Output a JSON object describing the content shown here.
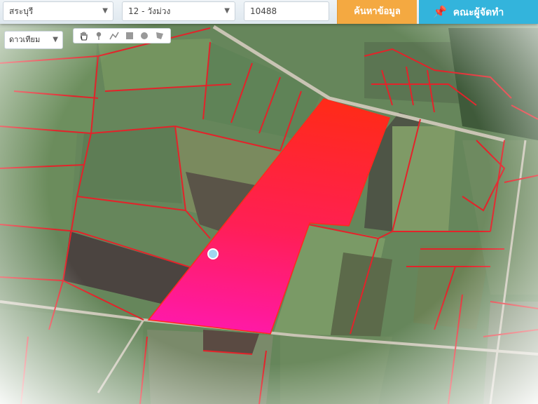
{
  "header": {
    "province": "สระบุรี",
    "district": "12 - วังม่วง",
    "parcel_number": "10488",
    "search_label": "ค้นหาข้อมูล",
    "dev_label": "คณะผู้จัดทำ"
  },
  "map": {
    "basemap_selected": "ดาวเทียม",
    "highlight_colors": [
      "#ff2a1a",
      "#ff2a6e",
      "#ff19a8"
    ],
    "parcel_line_color": "#e3232a",
    "tools": [
      "hand-icon",
      "marker-icon",
      "line-icon",
      "rectangle-icon",
      "circle-icon",
      "polygon-icon"
    ]
  }
}
